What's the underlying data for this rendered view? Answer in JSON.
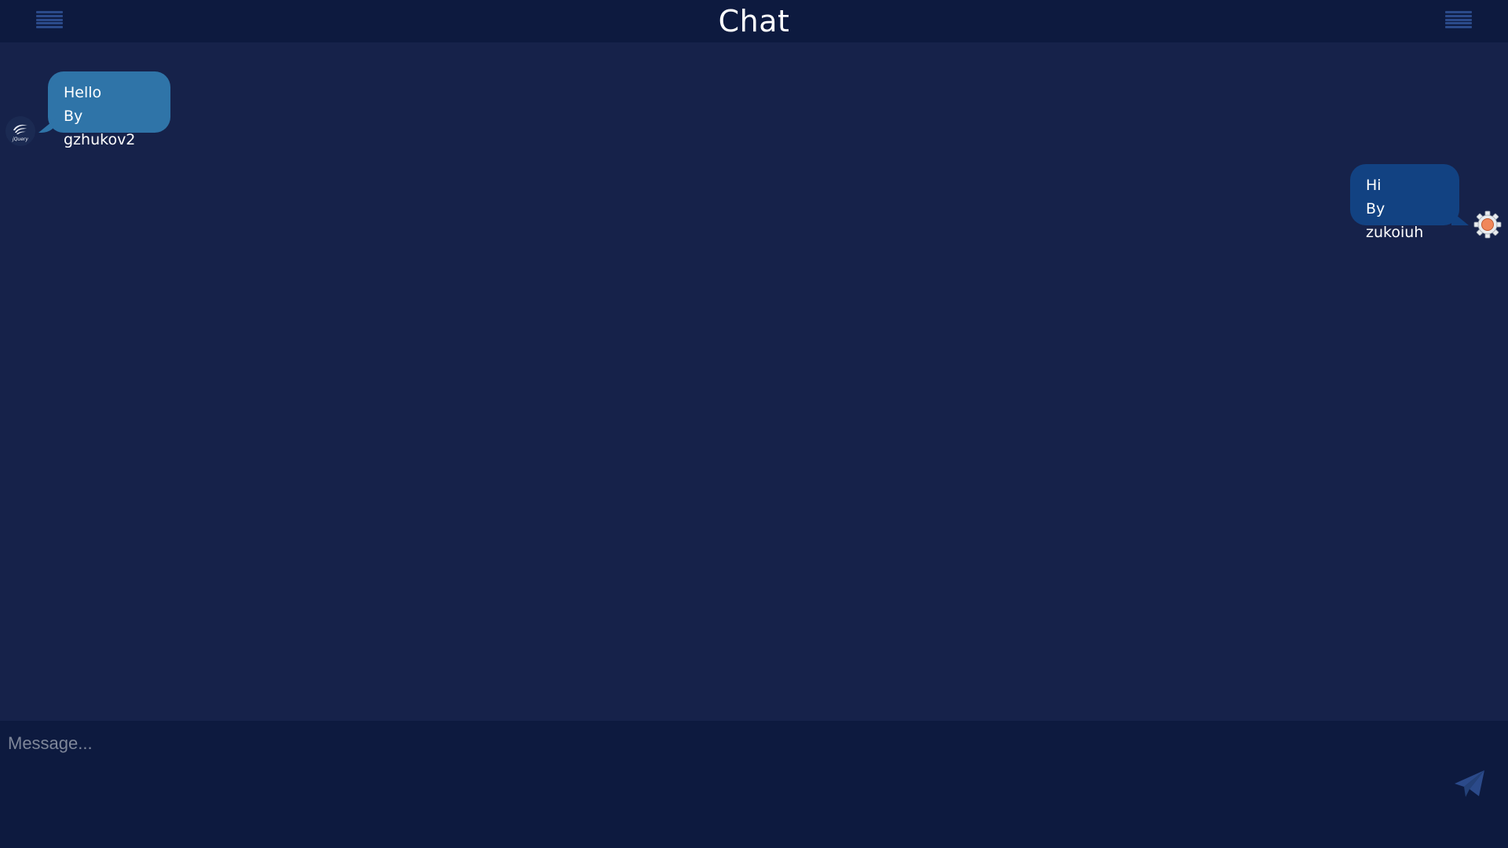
{
  "header": {
    "title": "Chat",
    "left_menu_icon": "hamburger-menu-icon",
    "right_menu_icon": "hamburger-menu-icon"
  },
  "messages": [
    {
      "text": "Hello",
      "author_line": "By gzhukov2",
      "side": "left",
      "avatar": "jquery-logo-avatar",
      "color": "#2f74a8"
    },
    {
      "text": "Hi",
      "author_line": "By zukoiuh",
      "side": "right",
      "avatar": "gear-avatar",
      "color": "#124282"
    }
  ],
  "composer": {
    "placeholder": "Message...",
    "value": "",
    "send_icon": "paper-plane-icon"
  },
  "colors": {
    "background": "#16224a",
    "header": "#0d1a3f",
    "accent": "#2b4a8a"
  }
}
